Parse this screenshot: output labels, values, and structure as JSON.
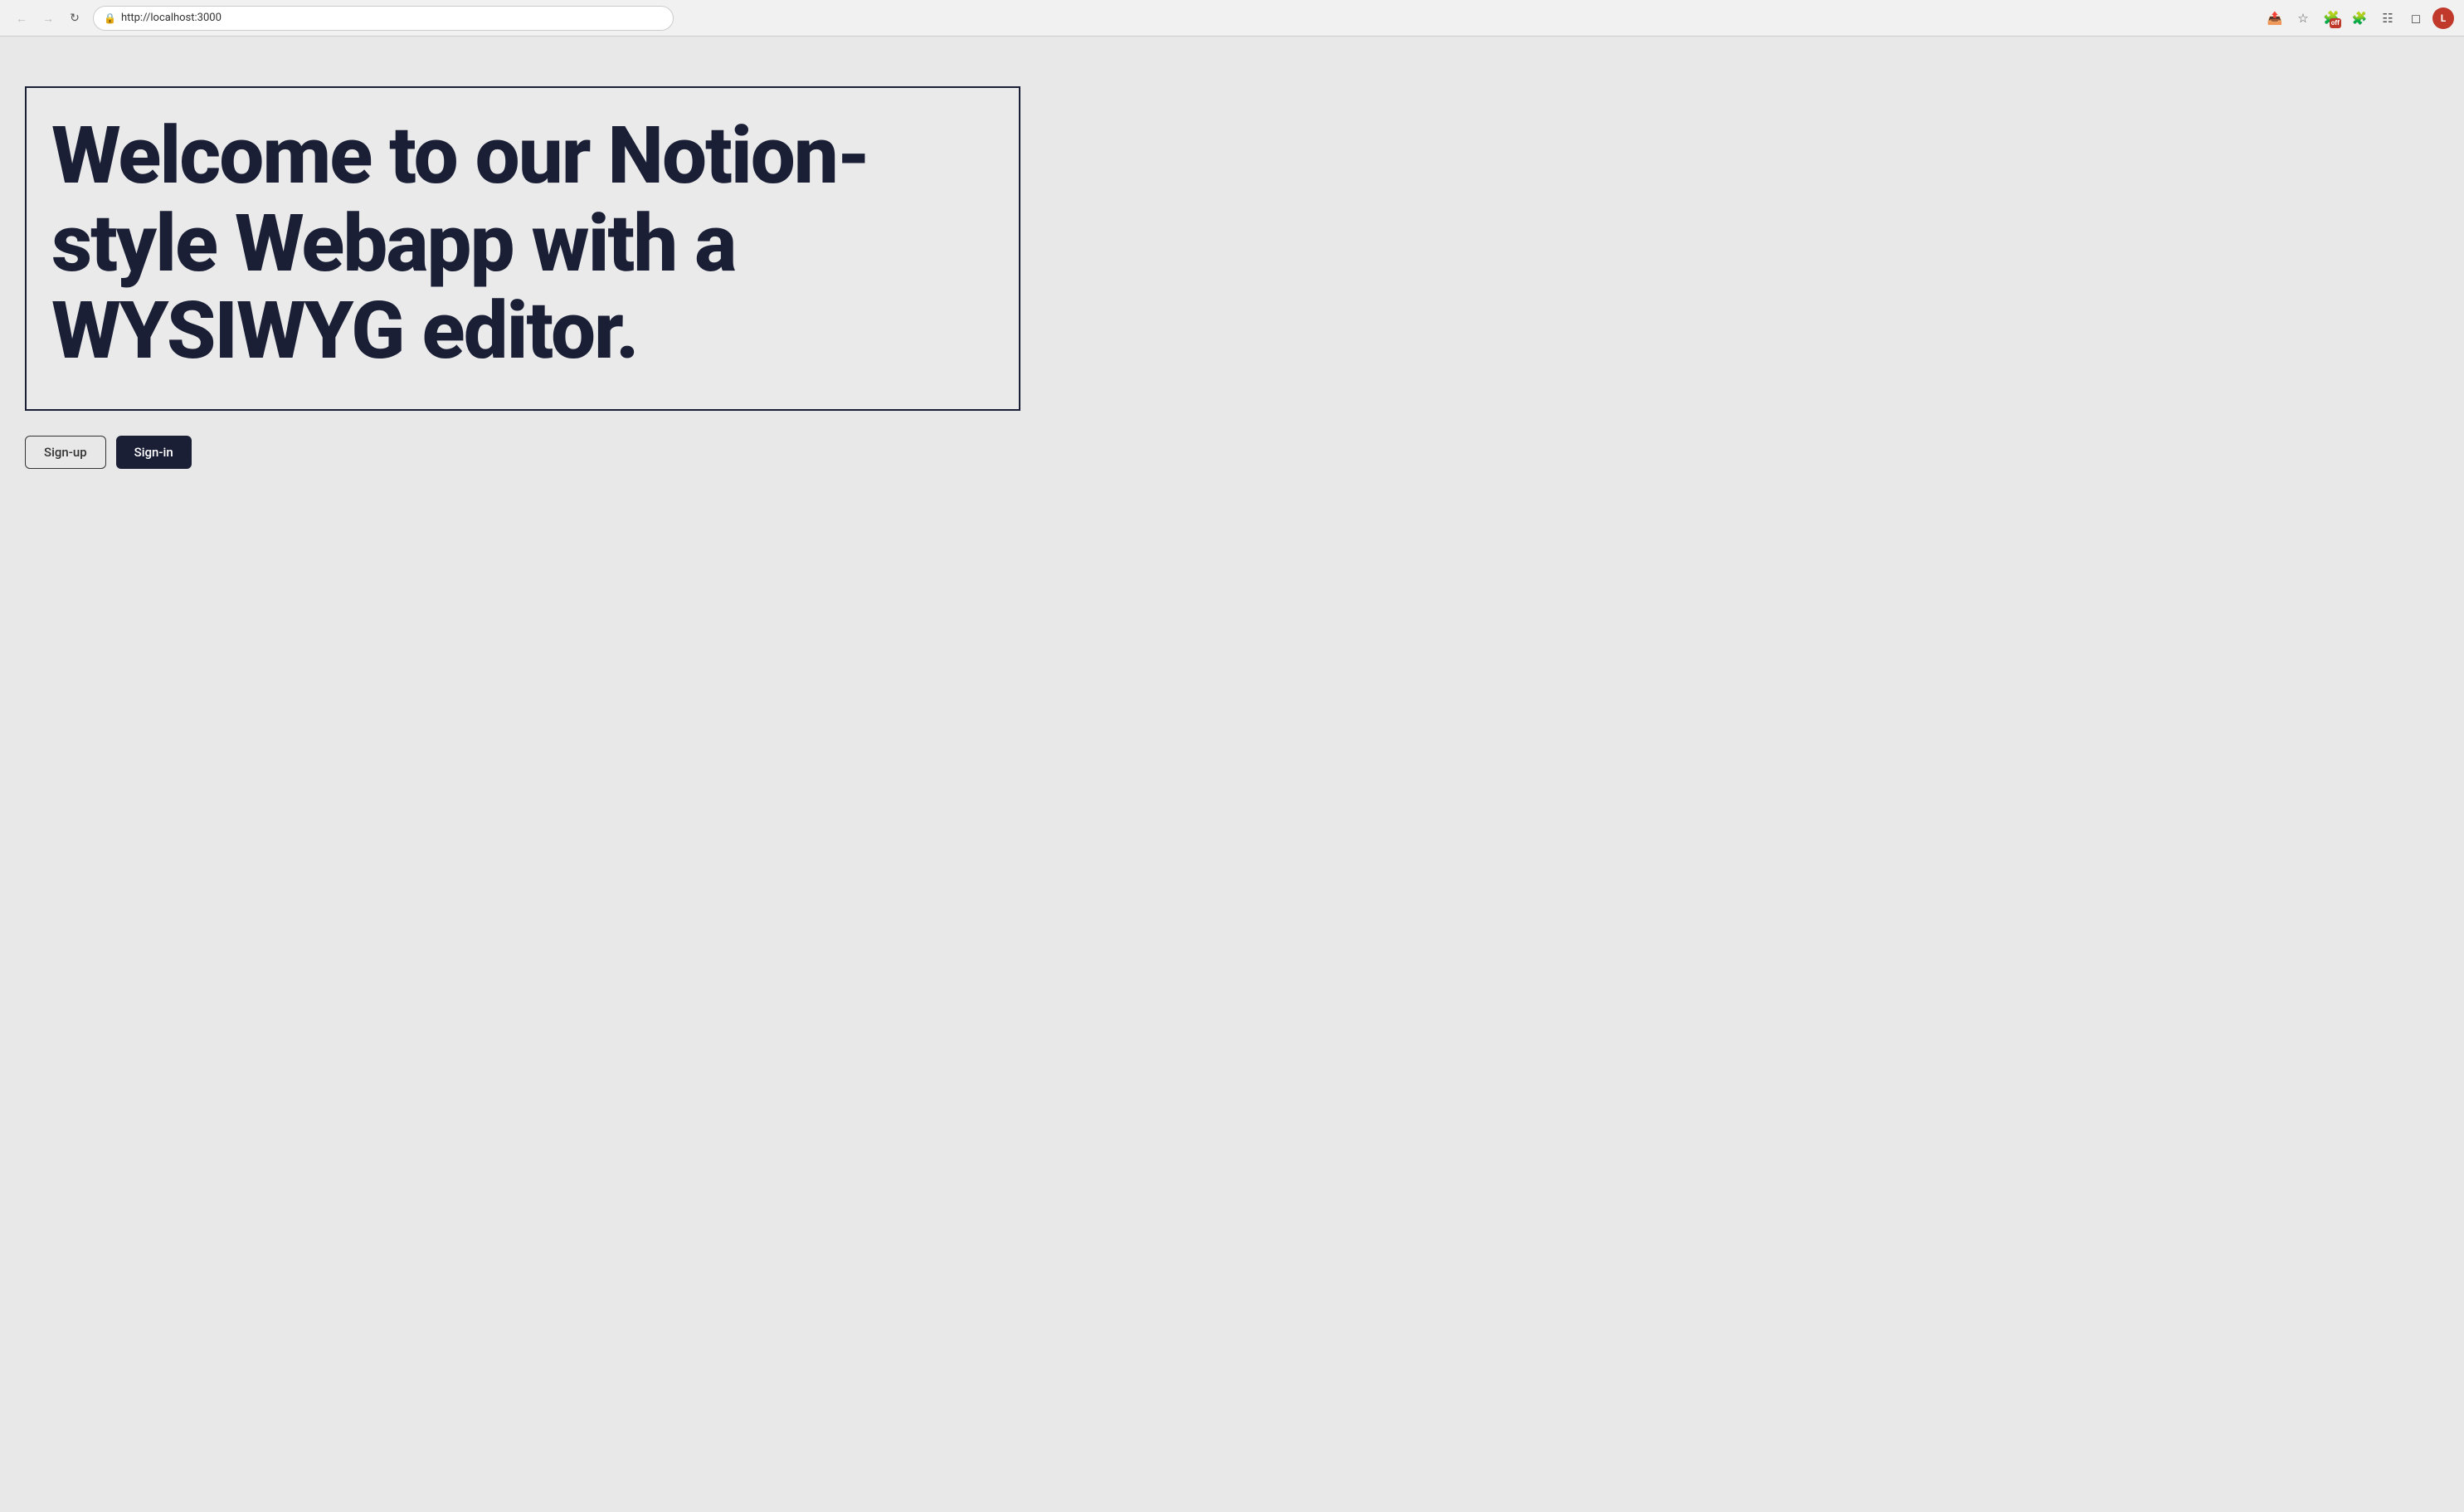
{
  "browser": {
    "url": "http://localhost:3000",
    "back_button": "←",
    "forward_button": "→",
    "refresh_button": "↻",
    "nav_icon": "🔒",
    "toolbar_items": {
      "save_icon": "⬆",
      "star_icon": "☆",
      "extensions_badge": "off",
      "puzzle_icon": "🧩",
      "menu_icon": "☰",
      "window_icon": "⬜",
      "profile_letter": "L"
    }
  },
  "page": {
    "hero_title": "Welcome to our Notion-style Webapp with a WYSIWYG editor.",
    "signup_label": "Sign-up",
    "signin_label": "Sign-in"
  }
}
